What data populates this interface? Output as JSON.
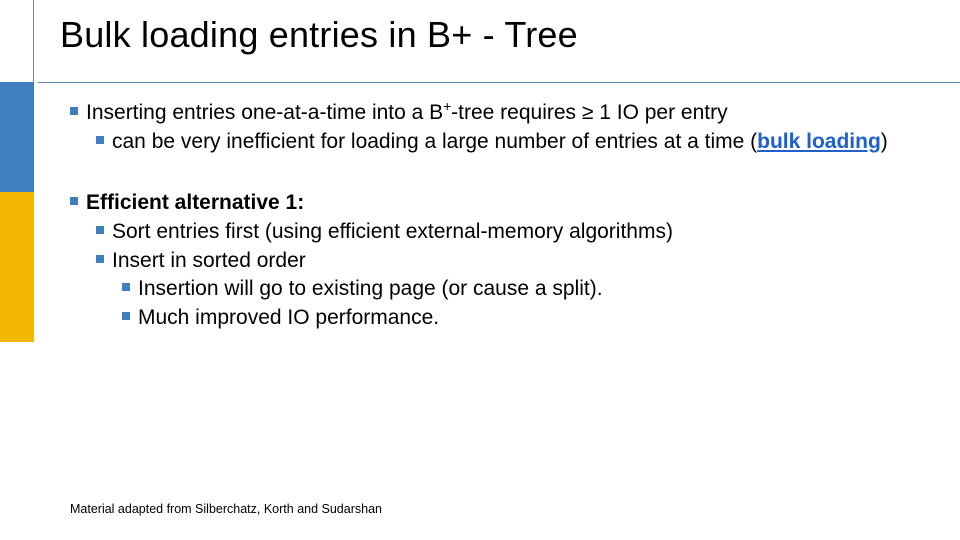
{
  "title": "Bulk loading entries in B+ - Tree",
  "bullets": {
    "b1": {
      "pre": "Inserting entries one-at-a-time into a B",
      "sup": "+",
      "post": "-tree requires ≥ 1 IO per entry",
      "sub_pre": "can be very inefficient for loading a large number of entries at a time (",
      "sub_link": "bulk loading",
      "sub_post": ")"
    },
    "b2": {
      "head": "Efficient alternative 1:",
      "s1": "Sort entries first (using efficient external-memory algorithms)",
      "s2": "Insert in sorted order",
      "s2a": "Insertion will go to existing page (or cause a split).",
      "s2b": "Much improved IO performance."
    }
  },
  "footer": "Material adapted from Silberchatz, Korth and Sudarshan"
}
